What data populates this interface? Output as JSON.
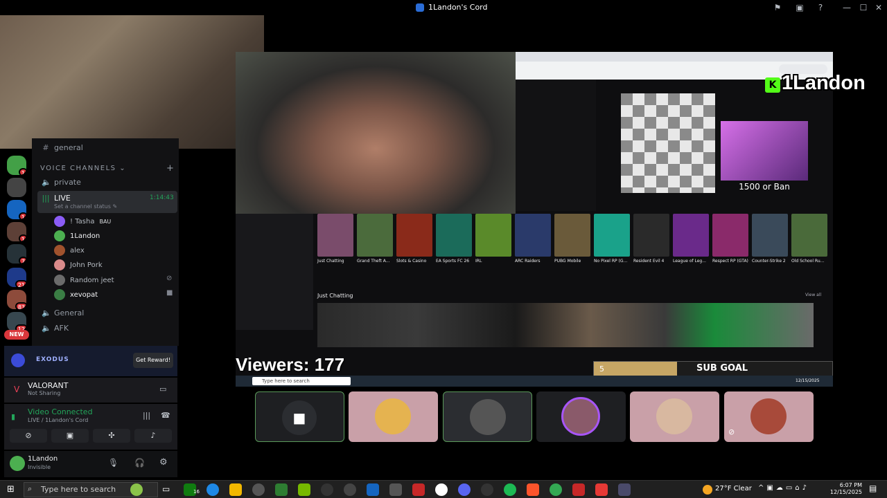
{
  "window": {
    "title": "1Landon's Cord"
  },
  "overlay": {
    "streamer_name": "1Landon",
    "viewers_text": "Viewers: 177",
    "subgoal_label": "SUB GOAL",
    "subgoal_count": "5",
    "chess_caption": "1500 or Ban"
  },
  "sidebar": {
    "partial_channel": "general",
    "category": "VOICE CHANNELS",
    "channels_before": [
      {
        "name": "private"
      }
    ],
    "live_channel": {
      "name": "LIVE",
      "timer": "1:14:43",
      "status_placeholder": "Set a channel status"
    },
    "voice_users": [
      {
        "name": "! Tasha",
        "badge": "BAU",
        "color": "#8b5cf6"
      },
      {
        "name": "1Landon",
        "color": "#4caf50"
      },
      {
        "name": "alex",
        "color": "#a0522d"
      },
      {
        "name": "John Pork",
        "color": "#d98a8a"
      },
      {
        "name": "Random jeet",
        "color": "#6b6b6b"
      },
      {
        "name": "xevopat",
        "color": "#3a7d44"
      }
    ],
    "channels_after": [
      {
        "name": "General"
      },
      {
        "name": "AFK"
      }
    ]
  },
  "servers": [
    {
      "badge": "1",
      "color": "#43a047"
    },
    {
      "badge": "",
      "color": "#444"
    },
    {
      "badge": "1",
      "color": "#1565c0"
    },
    {
      "badge": "1",
      "color": "#5d4037"
    },
    {
      "badge": "7",
      "color": "#263238"
    },
    {
      "badge": "21",
      "color": "#1e3a8a"
    },
    {
      "badge": "83",
      "color": "#8d4b3b"
    },
    {
      "badge": "12",
      "color": "#37474f"
    }
  ],
  "rail_new_label": "NEW",
  "promo": {
    "brand": "EXODUS",
    "button": "Get Reward!"
  },
  "activity": {
    "game": "VALORANT",
    "status": "Not Sharing"
  },
  "voice_conn": {
    "status": "Video Connected",
    "location": "LIVE / 1Landon's Cord"
  },
  "user_panel": {
    "name": "1Landon",
    "status": "Invisible"
  },
  "stream_page": {
    "categories": [
      {
        "name": "Just Chatting",
        "color": "#7a4c6b"
      },
      {
        "name": "Grand Theft A...",
        "color": "#4b6b3c"
      },
      {
        "name": "Slots & Casino",
        "color": "#8a2a1a"
      },
      {
        "name": "EA Sports FC 26",
        "color": "#1b6b5a"
      },
      {
        "name": "IRL",
        "color": "#5a8a2a"
      },
      {
        "name": "ARC Raiders",
        "color": "#2a3a6a"
      },
      {
        "name": "PUBG Mobile",
        "color": "#6a5a3a"
      },
      {
        "name": "No Pixel RP (G...",
        "color": "#1aa28a"
      },
      {
        "name": "Resident Evil 4",
        "color": "#2a2a2a"
      },
      {
        "name": "League of Leg...",
        "color": "#6a2a8a"
      },
      {
        "name": "Respect RP (GTA)",
        "color": "#8a2a6a"
      },
      {
        "name": "Counter-Strike 2",
        "color": "#3a4a5a"
      },
      {
        "name": "Old School Ru...",
        "color": "#4a6a3a"
      }
    ],
    "section_title": "Just Chatting",
    "view_all": "View all"
  },
  "voice_tiles": [
    {
      "color": "#1e1f22"
    },
    {
      "color": "#c9a0a8"
    },
    {
      "color": "#2b2d31"
    },
    {
      "color": "#1e1f22"
    },
    {
      "color": "#c9a0a8"
    },
    {
      "color": "#c9a0a8"
    }
  ],
  "taskbar": {
    "search_placeholder": "Type here to search",
    "badge_count": "16",
    "weather": "27°F  Clear",
    "time": "6:07 PM",
    "date": "12/15/2025"
  },
  "stream_taskbar": {
    "search_placeholder": "Type here to search",
    "date": "12/15/2025"
  }
}
